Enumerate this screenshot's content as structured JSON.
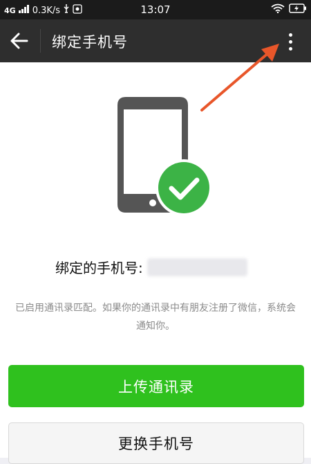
{
  "status_bar": {
    "network": "4G",
    "speed": "0.3K/s",
    "time": "13:07"
  },
  "appbar": {
    "title": "绑定手机号"
  },
  "main": {
    "phone_label": "绑定的手机号:",
    "description": "已启用通讯录匹配。如果你的通讯录中有朋友注册了微信，系统会通知你。",
    "upload_button": "上传通讯录",
    "change_button": "更换手机号"
  },
  "colors": {
    "accent_green": "#2fc11e",
    "appbar_bg": "#2e2e2e",
    "annotation_arrow": "#e8562a"
  },
  "icons": {
    "back": "arrow-left-icon",
    "more": "more-vertical-icon",
    "check": "check-circle-icon"
  }
}
